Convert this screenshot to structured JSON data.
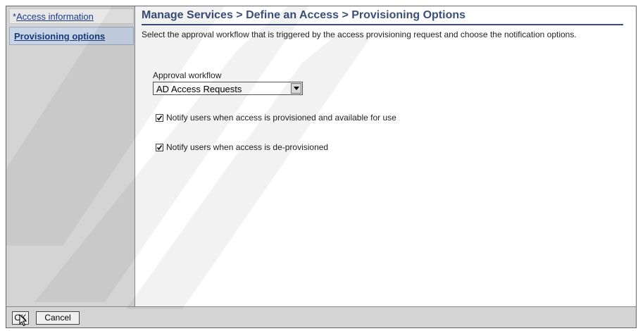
{
  "sidebar": {
    "items": [
      {
        "label": "Access information",
        "marker": "*",
        "active": false
      },
      {
        "label": "Provisioning options",
        "active": true
      }
    ]
  },
  "header": {
    "title": "Manage Services > Define an Access > Provisioning Options"
  },
  "main": {
    "description": "Select the approval workflow that is triggered by the access provisioning request and choose the notification options.",
    "approval_workflow": {
      "label": "Approval workflow",
      "value": "AD Access Requests"
    },
    "checkboxes": [
      {
        "label": "Notify users when access is provisioned and available for use",
        "checked": true
      },
      {
        "label": "Notify users when access is de-provisioned",
        "checked": true
      }
    ]
  },
  "footer": {
    "ok_label": "OK",
    "cancel_label": "Cancel"
  },
  "colors": {
    "sidebar_bg": "#d4d4d4",
    "active_item_bg": "#c9d5e6",
    "title": "#3a4f7a",
    "link": "#1a3c8c"
  }
}
